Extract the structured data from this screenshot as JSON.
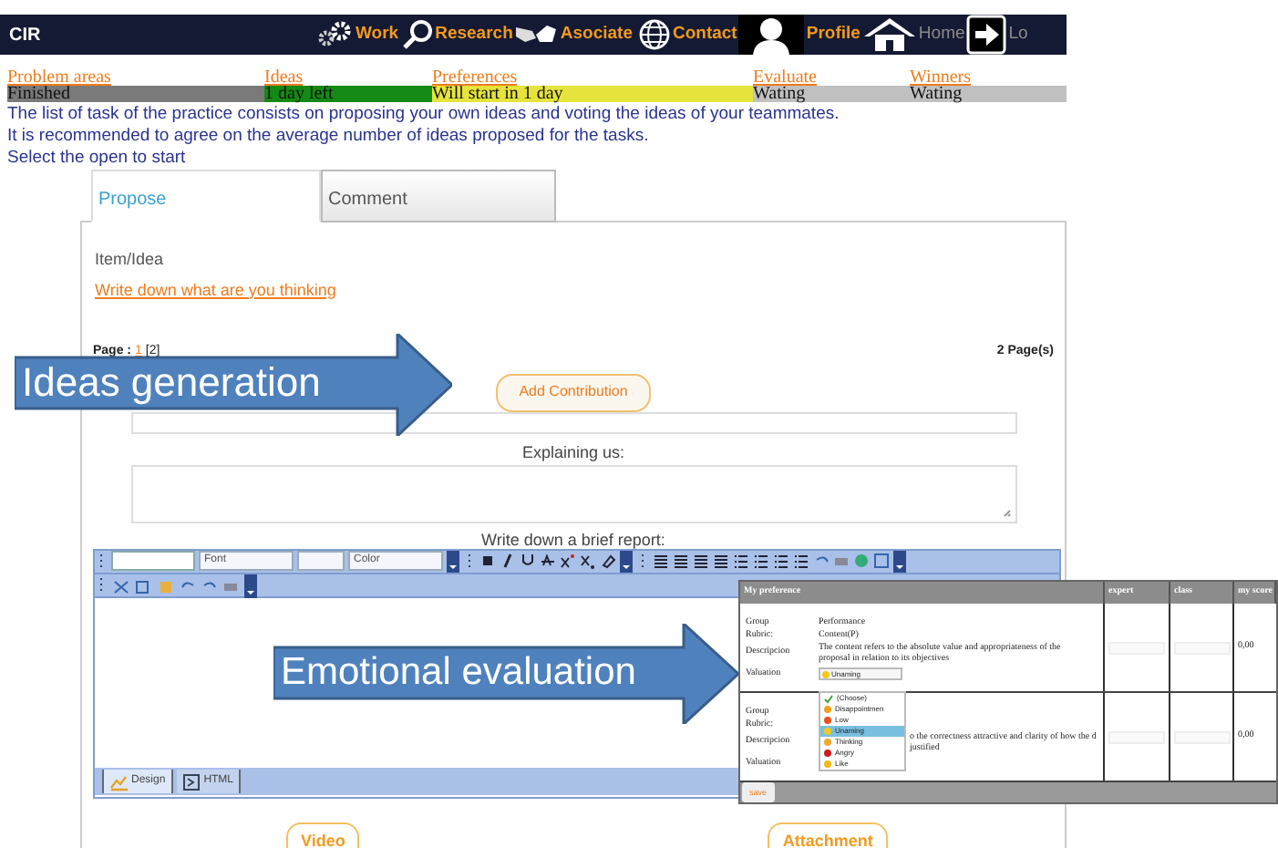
{
  "nav": {
    "brand": "CIR",
    "items": [
      {
        "label": "Work",
        "dimmed": false
      },
      {
        "label": "Research",
        "dimmed": false
      },
      {
        "label": "Asociate",
        "dimmed": false
      },
      {
        "label": "Contact",
        "dimmed": false
      },
      {
        "label": "Profile",
        "dimmed": false
      },
      {
        "label": "Home",
        "dimmed": true
      },
      {
        "label": "Lo",
        "dimmed": true
      }
    ]
  },
  "phases": [
    {
      "label": "Problem areas",
      "status": "Finished",
      "color": "#7a7a7a"
    },
    {
      "label": "Ideas",
      "status": "1 day left",
      "color": "#148a14"
    },
    {
      "label": "Preferences",
      "status": "Will start in 1 day",
      "color": "#e6e43c"
    },
    {
      "label": "Evaluate",
      "status": "Wating",
      "color": "#c0c0c0"
    },
    {
      "label": "Winners",
      "status": "Wating",
      "color": "#c0c0c0"
    }
  ],
  "intro": [
    "The list of task of the practice consists on proposing your own ideas and voting the ideas of your teammates.",
    "It is recommended to agree on the average number of ideas proposed for the tasks.",
    "Select the open to start"
  ],
  "tabs": [
    {
      "label": "Propose",
      "selected": true
    },
    {
      "label": "Comment",
      "selected": false
    }
  ],
  "item_heading": "Item/Idea",
  "item_link": "Write down what are you thinking",
  "pager": {
    "label": "Page :",
    "current": "1",
    "other": "[2]",
    "total": "2 Page(s)"
  },
  "add_button": "Add Contribution",
  "explain_label": "Explaining us:",
  "report_label": "Write down  a brief report:",
  "editor": {
    "font_select": "Font",
    "color_select": "Color",
    "modes": [
      {
        "label": "Design",
        "selected": true
      },
      {
        "label": "HTML",
        "selected": false
      }
    ]
  },
  "buttons": [
    "Video",
    "Attachment"
  ],
  "callouts": [
    "Ideas generation",
    "Emotional evaluation"
  ],
  "preference": {
    "columns": [
      "My preference",
      "expert",
      "class",
      "my score"
    ],
    "rows": [
      {
        "group_label": "Group",
        "group": "Performance",
        "rubric_label": "Rubric:",
        "rubric": "Content(P)",
        "description_label": "Descripcion",
        "description": "The content refers to the absolute value and appropriateness of the proposal in relation to its objectives",
        "valuation_label": "Valuation",
        "valuation": {
          "value": "Unaming",
          "expanded": true,
          "options": [
            {
              "label": "(Choose)",
              "kind": "check",
              "color": "#3aa33a",
              "selected": false
            },
            {
              "label": "Disappointmen",
              "kind": "face",
              "color": "#f0a020",
              "selected": false
            },
            {
              "label": "Low",
              "kind": "face",
              "color": "#e8501c",
              "selected": false
            },
            {
              "label": "Unaming",
              "kind": "face",
              "color": "#f2c81c",
              "selected": true
            },
            {
              "label": "Thinking",
              "kind": "face",
              "color": "#f0a830",
              "selected": false
            },
            {
              "label": "Angry",
              "kind": "face",
              "color": "#c81e1e",
              "selected": false
            },
            {
              "label": "Like",
              "kind": "face",
              "color": "#f0b818",
              "selected": false
            }
          ]
        },
        "score": "0,00"
      },
      {
        "group_label": "Group",
        "rubric_label": "Rubric:",
        "description_label": "Descripcion",
        "description": "o the correctness attractive and clarity of how the d justified",
        "valuation_label": "Valuation",
        "score": "0,00"
      }
    ],
    "save": "save"
  }
}
